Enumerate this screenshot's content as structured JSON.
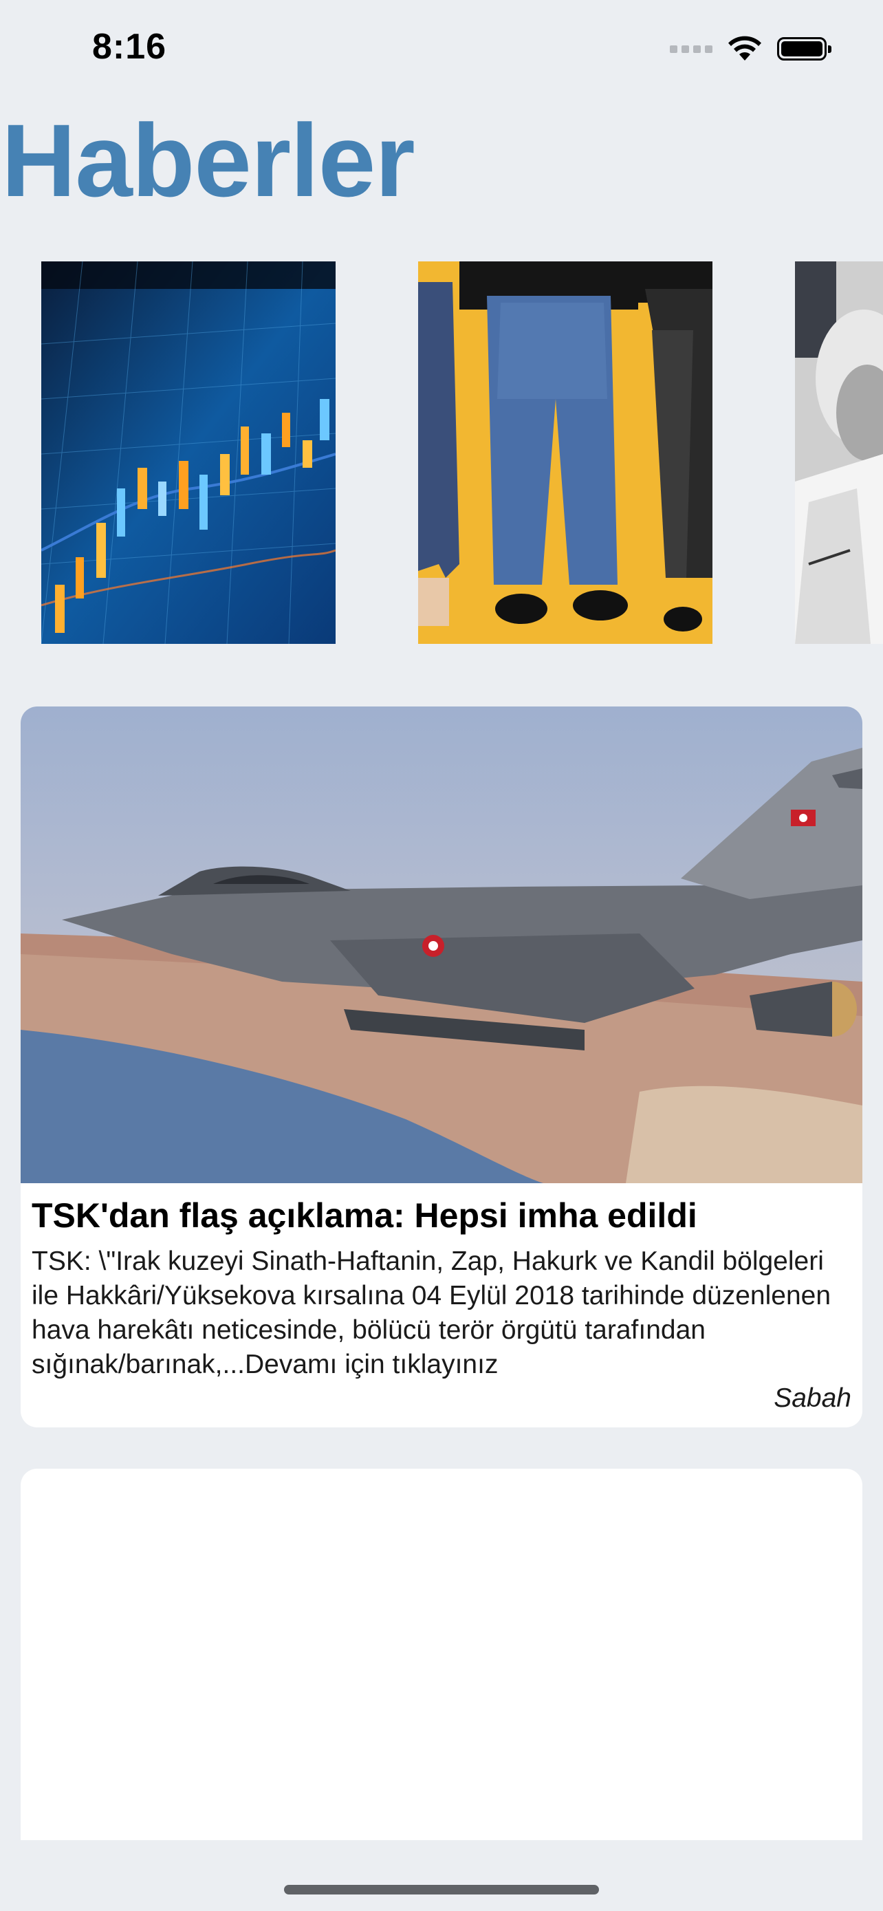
{
  "status_bar": {
    "time": "8:16",
    "icons": [
      "cellular-signal-icon",
      "wifi-icon",
      "battery-icon"
    ]
  },
  "header": {
    "title": "Haberler"
  },
  "colors": {
    "title": "#4682b4",
    "background": "#ebeef2",
    "card": "#ffffff"
  },
  "carousel": {
    "items": [
      {
        "image": "stock-chart-image"
      },
      {
        "image": "jeans-fashion-image"
      },
      {
        "image": "portrait-photo-image"
      }
    ]
  },
  "feed": {
    "cards": [
      {
        "image": "fighter-jet-image",
        "title": "TSK'dan flaş açıklama: Hepsi imha edildi",
        "summary": "TSK: \\\"Irak kuzeyi Sinath-Haftanin, Zap, Hakurk ve Kandil bölgeleri ile Hakkâri/Yüksekova kırsalına 04 Eylül 2018 tarihinde düzenlenen hava harekâtı neticesinde, bölücü terör örgütü tarafından sığınak/barınak,...Devamı için tıklayınız",
        "source": "Sabah"
      }
    ]
  }
}
